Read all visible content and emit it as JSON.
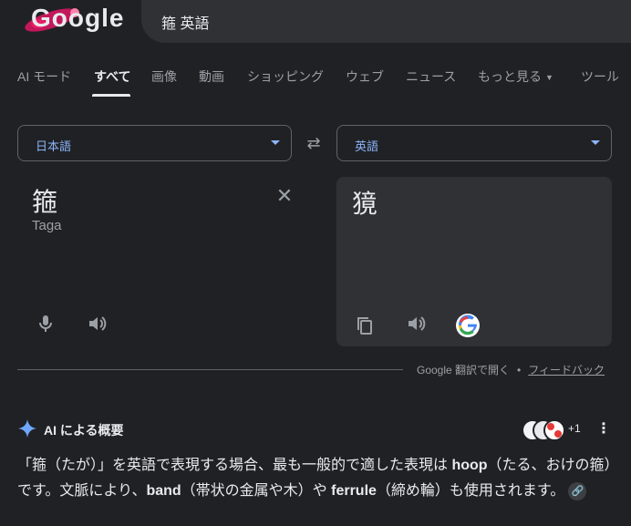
{
  "header": {
    "logo_text": "Google",
    "query": "箍 英語"
  },
  "tabs": [
    {
      "label": "AI モード"
    },
    {
      "label": "すべて"
    },
    {
      "label": "画像"
    },
    {
      "label": "動画"
    },
    {
      "label": "ショッピング"
    },
    {
      "label": "ウェブ"
    },
    {
      "label": "ニュース"
    },
    {
      "label": "もっと見る"
    },
    {
      "label": "ツール"
    }
  ],
  "translator": {
    "source_lang": "日本語",
    "target_lang": "英語",
    "source_text": "箍",
    "source_romanization": "Taga",
    "target_text": "獍",
    "footer_open": "Google 翻訳で開く",
    "footer_separator": "•",
    "footer_feedback": "フィードバック"
  },
  "ai_overview": {
    "title": "AI による概要",
    "more_count": "+1",
    "body_parts": [
      {
        "text": "「箍（たが）」を英語で表現する場合、最も一般的で適した表現は ",
        "bold": false
      },
      {
        "text": "hoop",
        "bold": true
      },
      {
        "text": "（たる、おけの箍）です。文脈により、",
        "bold": false
      },
      {
        "text": "band",
        "bold": true
      },
      {
        "text": "（帯状の金属や木）や ",
        "bold": false
      },
      {
        "text": "ferrule",
        "bold": true
      },
      {
        "text": "（締め輪）も使用されます。",
        "bold": false
      }
    ]
  },
  "colors": {
    "background": "#202124",
    "accent_blue": "#8ab4f8",
    "muted": "#9aa0a6"
  }
}
